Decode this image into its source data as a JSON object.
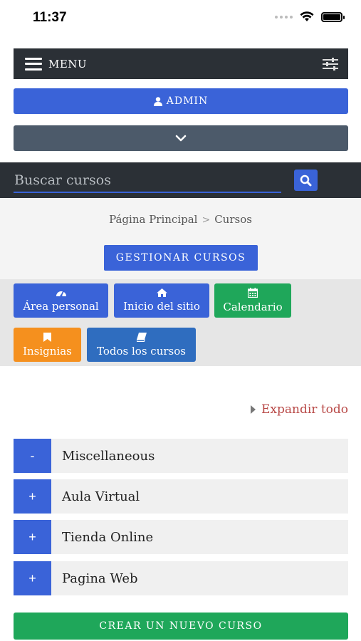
{
  "status_bar": {
    "time": "11:37"
  },
  "header": {
    "menu_label": "MENU",
    "admin_label": "ADMIN"
  },
  "search": {
    "placeholder": "Buscar cursos"
  },
  "breadcrumb": {
    "items": [
      "Página Principal",
      "Cursos"
    ]
  },
  "manage_button": "GESTIONAR CURSOS",
  "tiles": [
    {
      "label": "Área personal",
      "icon": "dashboard-icon",
      "color": "#3a63d8"
    },
    {
      "label": "Inicio del sitio",
      "icon": "home-icon",
      "color": "#3a63d8"
    },
    {
      "label": "Calendario",
      "icon": "calendar-icon",
      "color": "#1fa75a"
    },
    {
      "label": "Insignias",
      "icon": "bookmark-icon",
      "color": "#f5901e"
    },
    {
      "label": "Todos los cursos",
      "icon": "book-icon",
      "color": "#2f6dbf"
    }
  ],
  "expand_all": "Expandir todo",
  "categories": [
    {
      "toggle": "-",
      "name": "Miscellaneous"
    },
    {
      "toggle": "+",
      "name": "Aula Virtual"
    },
    {
      "toggle": "+",
      "name": "Tienda Online"
    },
    {
      "toggle": "+",
      "name": "Pagina Web"
    }
  ],
  "create_button": "CREAR UN NUEVO CURSO",
  "colors": {
    "primary": "#3a63d8",
    "success": "#1fa75a",
    "warning": "#f5901e",
    "dark": "#2b3036",
    "link": "#b94a48"
  }
}
